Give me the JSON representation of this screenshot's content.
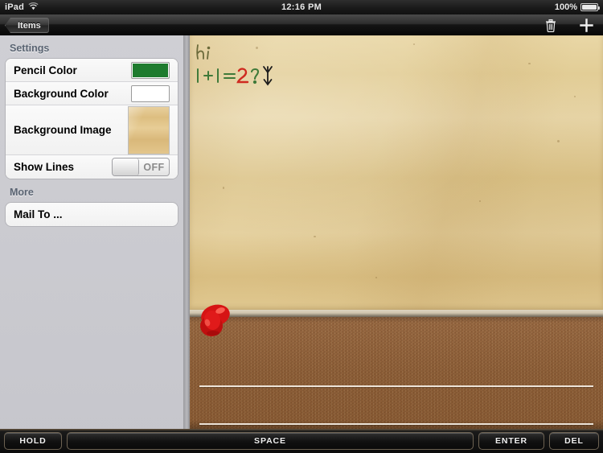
{
  "status_bar": {
    "device": "iPad",
    "wifi_icon": "wifi-icon",
    "time": "12:16 PM",
    "battery_percent": "100%",
    "battery_icon": "battery-icon"
  },
  "nav_bar": {
    "back_label": "Items",
    "delete_icon": "trash-icon",
    "add_icon": "plus-icon"
  },
  "sidebar": {
    "sections": [
      {
        "header": "Settings",
        "rows": [
          {
            "label": "Pencil Color",
            "control": "color-swatch",
            "value": "#1e7b2e"
          },
          {
            "label": "Background Color",
            "control": "color-swatch",
            "value": "#ffffff"
          },
          {
            "label": "Background Image",
            "control": "image-thumbnail",
            "value": "parchment"
          },
          {
            "label": "Show Lines",
            "control": "toggle",
            "value": "OFF"
          }
        ]
      },
      {
        "header": "More",
        "rows": [
          {
            "label": "Mail To ...",
            "control": "none",
            "value": ""
          }
        ]
      }
    ]
  },
  "canvas": {
    "background_image": "parchment-paper",
    "board": "cork-board",
    "pin_icon": "pushpin-icon",
    "handwriting": [
      {
        "text": "hi",
        "color": "#6b6a3a"
      },
      {
        "text": "1 + 1 =",
        "color": "#3f7a3a"
      },
      {
        "text": "2",
        "color": "#cf2a20"
      },
      {
        "text": "?",
        "color": "#3f7a3a"
      },
      {
        "text": "arrow",
        "color": "#1c1c1c"
      }
    ],
    "ruled_lines": 2
  },
  "keybar": {
    "keys": [
      {
        "label": "HOLD"
      },
      {
        "label": "SPACE"
      },
      {
        "label": "ENTER"
      },
      {
        "label": "DEL"
      }
    ]
  },
  "colors": {
    "pencil": "#1e7b2e",
    "background": "#ffffff",
    "cork": "#8e6039",
    "paper": "#e2cd96"
  }
}
